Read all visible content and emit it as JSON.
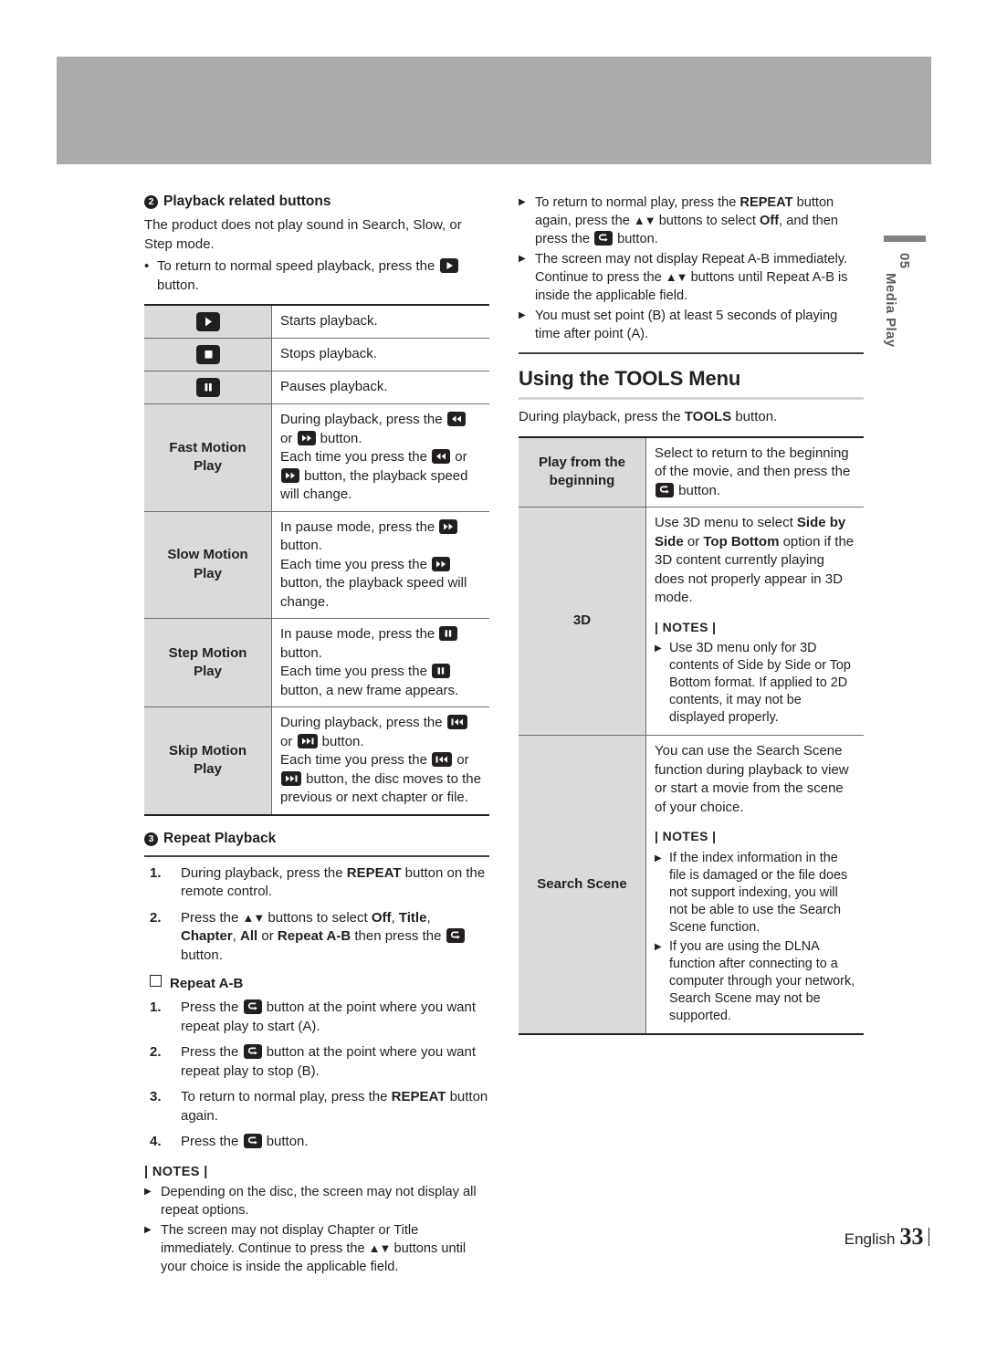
{
  "page": {
    "chapter_number": "05",
    "chapter_name": "Media Play",
    "footer_language": "English",
    "footer_page": "33"
  },
  "left_column": {
    "section2": {
      "bullet": "2",
      "title": "Playback related buttons",
      "intro": "The product does not play sound in Search, Slow, or Step mode.",
      "dot_item_pre": "To return to normal speed playback, press the",
      "dot_item_post": "button.",
      "table": [
        {
          "icon": "play-icon",
          "key_text": "",
          "desc": "Starts playback."
        },
        {
          "icon": "stop-icon",
          "key_text": "",
          "desc": "Stops playback."
        },
        {
          "icon": "pause-icon",
          "key_text": "",
          "desc": "Pauses playback."
        },
        {
          "icon": "",
          "key_text": "Fast Motion Play",
          "desc_parts": [
            "During playback, press the",
            "rewind-icon",
            "or",
            "forward-icon",
            "button.",
            "Each time you press the",
            "rewind-icon",
            "or",
            "forward-icon",
            "button, the playback speed will change."
          ]
        },
        {
          "icon": "",
          "key_text": "Slow Motion Play",
          "desc_parts": [
            "In pause mode, press the",
            "forward-icon",
            "button.",
            "Each time you press the",
            "forward-icon",
            "button, the playback speed will change."
          ]
        },
        {
          "icon": "",
          "key_text": "Step Motion Play",
          "desc_parts": [
            "In pause mode, press the",
            "pause-icon",
            "button.",
            "Each time you press the",
            "pause-icon",
            "button, a new frame appears."
          ]
        },
        {
          "icon": "",
          "key_text": "Skip Motion Play",
          "desc_parts": [
            "During playback, press the",
            "skip-back-icon",
            "or",
            "skip-forward-icon",
            "button.",
            "Each time you press the",
            "skip-back-icon",
            "or",
            "skip-forward-icon",
            "button, the disc moves to the previous or next chapter or file."
          ]
        }
      ]
    },
    "section3": {
      "bullet": "3",
      "title": "Repeat Playback",
      "steps": [
        {
          "n": "1.",
          "text": "During playback, press the REPEAT button on the remote control."
        },
        {
          "n": "2.",
          "text": "Press the ▲▼ buttons to select Off, Title, Chapter, All or Repeat A-B then press the ENTER button."
        }
      ],
      "sub_head": "Repeat A-B",
      "sub_steps": [
        {
          "n": "1.",
          "text": "Press the ENTER button at the point where you want repeat play to start (A)."
        },
        {
          "n": "2.",
          "text": "Press the ENTER button at the point where you want repeat play to stop (B)."
        },
        {
          "n": "3.",
          "text": "To return to normal play, press the REPEAT button again."
        },
        {
          "n": "4.",
          "text": "Press the ENTER button."
        }
      ],
      "notes_title": "| NOTES |",
      "notes": [
        "Depending on the disc, the screen may not display all repeat options.",
        "The screen may not display Chapter or Title immediately. Continue to press the ▲▼ buttons until your choice is inside the applicable field."
      ]
    }
  },
  "right_column": {
    "top_notes": [
      "To return to normal play, press the REPEAT button again, press the ▲▼ buttons to select Off, and then press the ENTER button.",
      "The screen may not display Repeat A-B immediately. Continue to press the ▲▼ buttons until Repeat A-B is inside the applicable field.",
      "You must set point (B) at least 5 seconds of  playing time after point (A)."
    ],
    "tools": {
      "heading": "Using the TOOLS Menu",
      "intro": "During playback, press the TOOLS button.",
      "rows": [
        {
          "key_text": "Play from the beginning",
          "desc": "Select to return to the beginning of the movie, and then press the ENTER button."
        },
        {
          "key_text": "3D",
          "desc": "Use 3D menu to select Side by Side or Top Bottom option if the 3D content currently playing does not properly appear in 3D mode.",
          "notes_title": "| NOTES |",
          "notes": [
            "Use 3D menu only for 3D contents of Side by Side or Top Bottom format. If applied to 2D contents, it may not be displayed properly."
          ]
        },
        {
          "key_text": "Search Scene",
          "desc": "You can use the Search Scene function during playback to view or start a movie from the scene of your choice.",
          "notes_title": "| NOTES |",
          "notes": [
            "If the index information in the file is damaged or the file does not support indexing, you will not be able to use the Search Scene function.",
            "If you are using the DLNA function after connecting to a computer through your network, Search Scene may not be supported."
          ]
        }
      ]
    }
  },
  "icons": {
    "play": "play-icon",
    "stop": "stop-icon",
    "pause": "pause-icon",
    "rewind": "rewind-icon",
    "forward": "forward-icon",
    "skip_back": "skip-back-icon",
    "skip_forward": "skip-forward-icon",
    "enter": "enter-icon"
  },
  "colors": {
    "text": "#231f20",
    "key_cell_bg": "#d9dadb",
    "table_border": "#6d6e71",
    "rule_heavy": "#231f20",
    "rule_light": "#d1d3d4"
  }
}
